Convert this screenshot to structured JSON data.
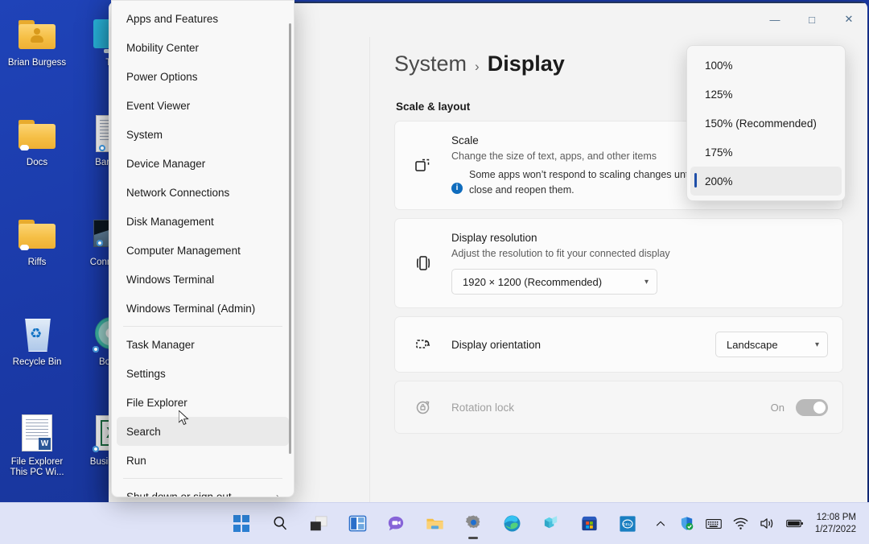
{
  "desktop": {
    "icons": [
      {
        "label": "Brian Burgess",
        "icon": "user-folder-icon"
      },
      {
        "label": "Th",
        "icon": "monitor-icon"
      },
      {
        "label": "Docs",
        "icon": "folder-icon"
      },
      {
        "label": "Bar\nAss",
        "icon": "document-icon"
      },
      {
        "label": "Riffs",
        "icon": "folder-icon"
      },
      {
        "label": "Conn\nMes",
        "icon": "image-icon"
      },
      {
        "label": "Recycle Bin",
        "icon": "recycle-bin-icon"
      },
      {
        "label": "Boom",
        "icon": "disc-icon"
      },
      {
        "label": "File Explorer This PC Wi...",
        "icon": "word-document-icon"
      },
      {
        "label": "Busin\nBud",
        "icon": "excel-document-icon"
      }
    ]
  },
  "context_menu": {
    "items": [
      {
        "label": "Apps and Features",
        "has_submenu": false
      },
      {
        "label": "Mobility Center",
        "has_submenu": false
      },
      {
        "label": "Power Options",
        "has_submenu": false
      },
      {
        "label": "Event Viewer",
        "has_submenu": false
      },
      {
        "label": "System",
        "has_submenu": false
      },
      {
        "label": "Device Manager",
        "has_submenu": false
      },
      {
        "label": "Network Connections",
        "has_submenu": false
      },
      {
        "label": "Disk Management",
        "has_submenu": false
      },
      {
        "label": "Computer Management",
        "has_submenu": false
      },
      {
        "label": "Windows Terminal",
        "has_submenu": false
      },
      {
        "label": "Windows Terminal (Admin)",
        "has_submenu": false
      },
      {
        "label": "Task Manager",
        "has_submenu": false
      },
      {
        "label": "Settings",
        "has_submenu": false
      },
      {
        "label": "File Explorer",
        "has_submenu": false
      },
      {
        "label": "Search",
        "has_submenu": false,
        "hovered": true
      },
      {
        "label": "Run",
        "has_submenu": false
      },
      {
        "label": "Shut down or sign out",
        "has_submenu": true,
        "submenu_glyph": "›"
      }
    ]
  },
  "settings": {
    "window_controls": {
      "minimize": "—",
      "maximize": "□",
      "close": "✕"
    },
    "breadcrumb": {
      "parent": "System",
      "separator": "›",
      "current": "Display"
    },
    "search": {
      "placeholder": "",
      "value": "",
      "icon": "search-icon"
    },
    "section_title": "Scale & layout",
    "scale_card": {
      "icon": "scale-icon",
      "title": "Scale",
      "subtitle": "Change the size of text, apps, and other items",
      "info_icon": "info-icon",
      "info_text": "Some apps won’t respond to scaling changes until you close and reopen them."
    },
    "resolution_card": {
      "icon": "resolution-icon",
      "title": "Display resolution",
      "subtitle": "Adjust the resolution to fit your connected display",
      "value": "1920 × 1200 (Recommended)",
      "chevron": "⌄"
    },
    "orientation_card": {
      "icon": "orientation-icon",
      "title": "Display orientation",
      "value": "Landscape",
      "chevron": "⌄"
    },
    "rotation_lock_card": {
      "icon": "rotation-lock-icon",
      "title": "Rotation lock",
      "state_label": "On",
      "enabled": false
    },
    "scale_dropdown": {
      "options": [
        {
          "label": "100%",
          "selected": false
        },
        {
          "label": "125%",
          "selected": false
        },
        {
          "label": "150% (Recommended)",
          "selected": false
        },
        {
          "label": "175%",
          "selected": false
        },
        {
          "label": "200%",
          "selected": true
        }
      ],
      "accent_color": "#1f4fa8"
    }
  },
  "taskbar": {
    "buttons": [
      {
        "name": "start-button",
        "icon": "windows-logo-icon",
        "active": false
      },
      {
        "name": "search-button",
        "icon": "search-icon",
        "active": false
      },
      {
        "name": "task-view-button",
        "icon": "task-view-icon",
        "active": false
      },
      {
        "name": "widgets-button",
        "icon": "widgets-icon",
        "active": false
      },
      {
        "name": "chat-button",
        "icon": "chat-icon",
        "active": false
      },
      {
        "name": "file-explorer-button",
        "icon": "folder-icon",
        "active": false
      },
      {
        "name": "settings-button",
        "icon": "gear-icon",
        "active": true
      },
      {
        "name": "edge-button",
        "icon": "edge-icon",
        "active": false
      },
      {
        "name": "teams-button",
        "icon": "stack-icon",
        "active": false
      },
      {
        "name": "microsoft-store-button",
        "icon": "store-icon",
        "active": false
      },
      {
        "name": "dell-button",
        "icon": "dell-icon",
        "active": false
      }
    ],
    "tray": [
      {
        "name": "show-hidden-icons-button",
        "icon": "chevron-up-icon"
      },
      {
        "name": "security-tray-icon",
        "icon": "shield-check-icon"
      },
      {
        "name": "keyboard-tray-icon",
        "icon": "keyboard-icon"
      },
      {
        "name": "network-tray-icon",
        "icon": "wifi-icon"
      },
      {
        "name": "volume-tray-icon",
        "icon": "speaker-icon"
      },
      {
        "name": "battery-tray-icon",
        "icon": "battery-icon"
      }
    ],
    "clock": {
      "time": "12:08 PM",
      "date": "1/27/2022"
    }
  },
  "colors": {
    "desktop_blue": "#1b3bab",
    "taskbar": "#dfe3f7",
    "accent": "#1f4fa8",
    "window_bg": "#f3f3f3",
    "card_bg": "#fbfbfb"
  }
}
